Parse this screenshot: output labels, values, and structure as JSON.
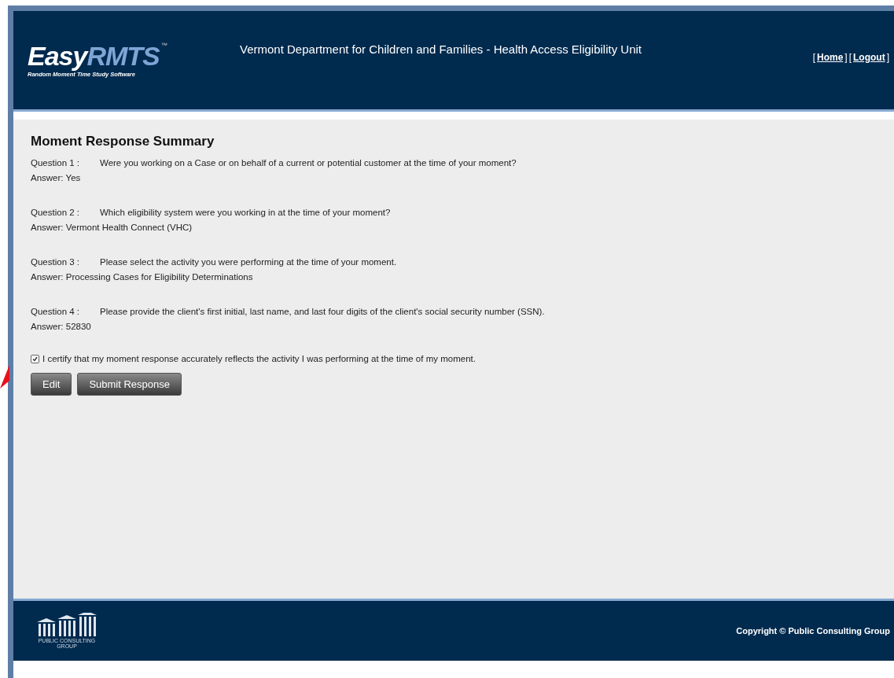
{
  "header": {
    "logo": {
      "brand_a": "Easy",
      "brand_b": "RMTS",
      "trademark": "™",
      "tagline": "Random Moment Time Study Software"
    },
    "title": "Vermont Department for Children and Families - Health Access Eligibility Unit",
    "links": [
      {
        "open": "[",
        "label": "Home",
        "close": "]"
      },
      {
        "open": "[",
        "label": "Logout",
        "close": "]"
      }
    ]
  },
  "summary": {
    "heading": "Moment Response Summary",
    "items": [
      {
        "label": "Question 1 :",
        "question": "Were you working on a Case or on behalf of a current or potential customer at the time of your moment?",
        "answer": "Answer: Yes"
      },
      {
        "label": "Question 2 :",
        "question": "Which eligibility system were you working in at the time of your moment?",
        "answer": "Answer: Vermont Health Connect (VHC)"
      },
      {
        "label": "Question 3 :",
        "question": "Please select the activity you were performing at the time of your moment.",
        "answer": "Answer: Processing Cases for Eligibility Determinations"
      },
      {
        "label": "Question 4 :",
        "question": "Please provide the client's first initial, last name, and last four digits of the client's social security number (SSN).",
        "answer": "Answer: 52830"
      }
    ],
    "certify": {
      "label": "I certify that my moment response accurately reflects the activity I was performing at the time of my moment.",
      "checked": true
    },
    "buttons": [
      "Edit",
      "Submit Response"
    ]
  },
  "footer": {
    "logo": {
      "line1": "PUBLIC CONSULTING",
      "line2": "GROUP"
    },
    "copyright": "Copyright © Public Consulting Group"
  }
}
